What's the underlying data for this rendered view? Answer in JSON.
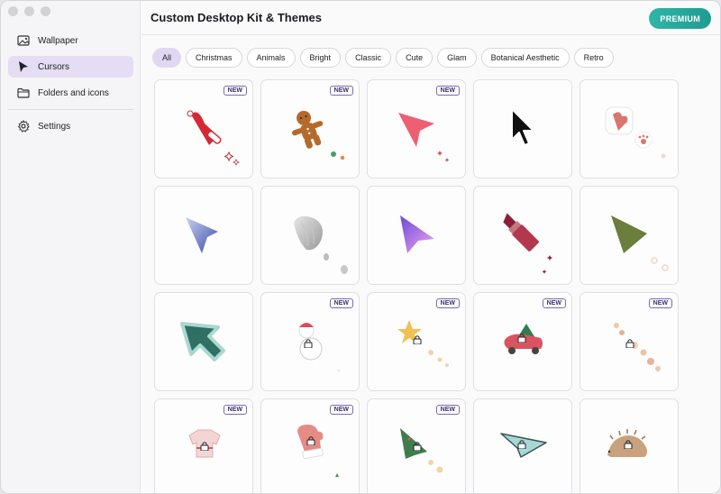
{
  "app": {
    "title": "Custom Desktop Kit & Themes",
    "premium_label": "PREMIUM",
    "accent": "#2fb5a6"
  },
  "sidebar": {
    "items": [
      {
        "label": "Wallpaper",
        "icon": "wallpaper-icon",
        "active": false
      },
      {
        "label": "Cursors",
        "icon": "cursor-icon",
        "active": true
      },
      {
        "label": "Folders and icons",
        "icon": "folder-icon",
        "active": false
      }
    ],
    "settings_label": "Settings"
  },
  "filters": {
    "chips": [
      "All",
      "Christmas",
      "Animals",
      "Bright",
      "Classic",
      "Cute",
      "Glam",
      "Botanical Aesthetic",
      "Retro"
    ],
    "selected": "All"
  },
  "cursors": {
    "new_label": "NEW",
    "items": [
      {
        "name": "santa-hat-cursor",
        "new": true,
        "locked": false
      },
      {
        "name": "gingerbread-cursor",
        "new": true,
        "locked": false
      },
      {
        "name": "pink-arrow-cursor",
        "new": true,
        "locked": false
      },
      {
        "name": "classic-black-cursor",
        "new": false,
        "locked": false
      },
      {
        "name": "heart-paw-cursor",
        "new": false,
        "locked": false
      },
      {
        "name": "blue-glass-cursor",
        "new": false,
        "locked": false
      },
      {
        "name": "silver-shell-cursor",
        "new": false,
        "locked": false
      },
      {
        "name": "purple-gradient-cursor",
        "new": false,
        "locked": false
      },
      {
        "name": "lipstick-cursor",
        "new": false,
        "locked": false
      },
      {
        "name": "olive-triangle-cursor",
        "new": false,
        "locked": false
      },
      {
        "name": "teal-arrow-cursor",
        "new": false,
        "locked": false
      },
      {
        "name": "snowman-cursor",
        "new": true,
        "locked": true
      },
      {
        "name": "star-wand-cursor",
        "new": true,
        "locked": true
      },
      {
        "name": "christmas-car-cursor",
        "new": true,
        "locked": true
      },
      {
        "name": "candy-cursor",
        "new": true,
        "locked": true
      },
      {
        "name": "christmas-sweater-cursor",
        "new": true,
        "locked": true
      },
      {
        "name": "mitten-cursor",
        "new": true,
        "locked": true
      },
      {
        "name": "christmas-tree-cursor",
        "new": true,
        "locked": true
      },
      {
        "name": "paper-plane-cursor",
        "new": false,
        "locked": true
      },
      {
        "name": "hedgehog-cursor",
        "new": false,
        "locked": true
      }
    ]
  }
}
